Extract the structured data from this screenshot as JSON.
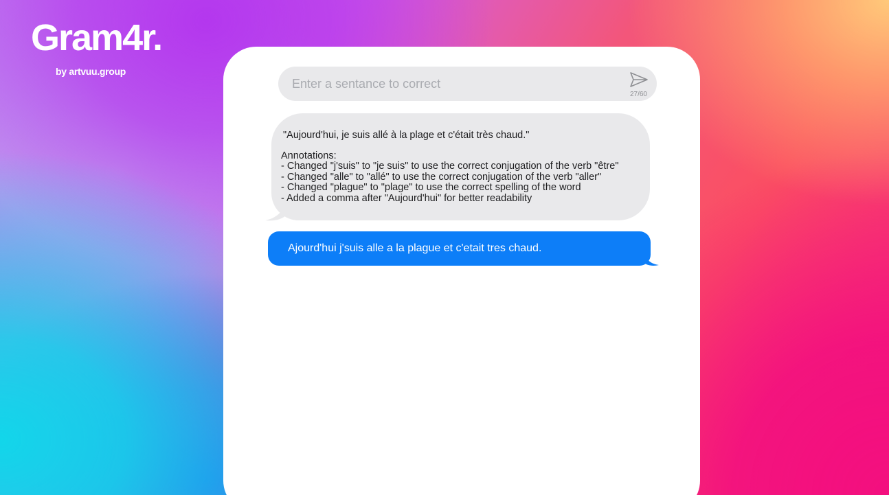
{
  "brand": {
    "logo": "Gram4r.",
    "subtitle": "by artvuu.group"
  },
  "input": {
    "placeholder": "Enter a sentance to correct",
    "value": "",
    "char_count": "27/60",
    "send_icon": "send-icon"
  },
  "messages": {
    "correction": {
      "quote": "\"Aujourd'hui, je suis allé à la plage et c'était très chaud.\"",
      "annotations_title": "Annotations:",
      "annotations": [
        "- Changed \"j'suis\" to \"je suis\" to use the correct conjugation of the verb \"être\"",
        "- Changed \"alle\" to \"allé\" to use the correct conjugation of the verb \"aller\"",
        "- Changed \"plague\" to \"plage\" to use the correct spelling of the word",
        "- Added a comma after \"Aujourd'hui\" for better readability"
      ]
    },
    "user": {
      "text": "Ajourd'hui j'suis alle a la plague et c'etait tres chaud."
    }
  },
  "colors": {
    "received_bubble": "#e9e9eb",
    "sent_bubble": "#0d7ef8",
    "panel": "#ffffff"
  }
}
